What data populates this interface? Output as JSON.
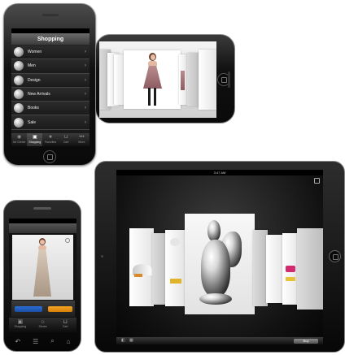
{
  "iphone_portrait": {
    "title": "Shopping",
    "categories": [
      {
        "label": "Women",
        "icon": "dress-icon"
      },
      {
        "label": "Men",
        "icon": "shirt-icon"
      },
      {
        "label": "Design",
        "icon": "lamp-icon"
      },
      {
        "label": "New Arrivals",
        "icon": "tag-icon"
      },
      {
        "label": "Books",
        "icon": "book-icon"
      },
      {
        "label": "Sale",
        "icon": "sale-icon"
      }
    ],
    "tabs": [
      {
        "label": "Art Center",
        "icon": "globe-icon"
      },
      {
        "label": "Shopping",
        "icon": "bag-icon",
        "active": true
      },
      {
        "label": "Favorites",
        "icon": "star-icon"
      },
      {
        "label": "Cart",
        "icon": "cart-icon"
      },
      {
        "label": "More",
        "icon": "more-icon"
      }
    ]
  },
  "iphone_landscape": {
    "view": "coverflow"
  },
  "android": {
    "tabs": [
      {
        "label": "Shopping",
        "icon": "bag-icon"
      },
      {
        "label": "Stores",
        "icon": "store-icon"
      },
      {
        "label": "Cart",
        "icon": "cart-icon"
      }
    ],
    "hw_keys": [
      "↶",
      "☰",
      "⌕",
      "⌂"
    ]
  },
  "ipad": {
    "status_time": "3:47 AM",
    "caption": "",
    "buy_label": "Buy"
  }
}
